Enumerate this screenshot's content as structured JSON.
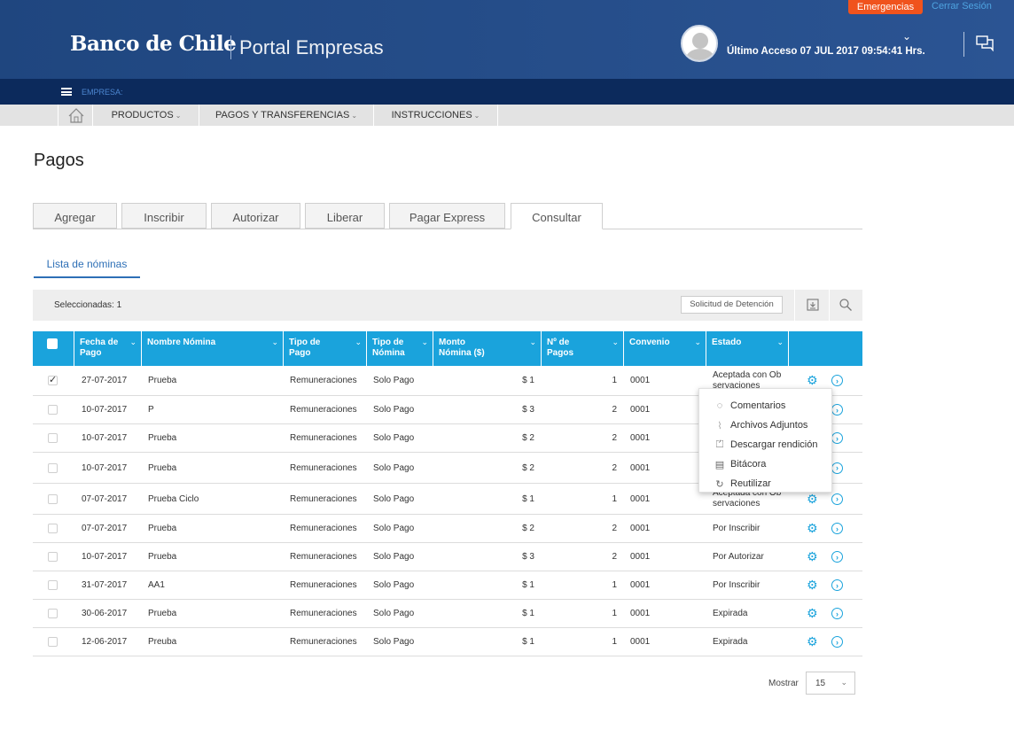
{
  "header": {
    "emergencias": "Emergencias",
    "cerrar_sesion": "Cerrar Sesión",
    "bank_name": "Banco de Chile",
    "portal": "Portal Empresas",
    "last_access": "Último Acceso 07 JUL 2017 09:54:41 Hrs.",
    "chevron": "⌄"
  },
  "company_bar": {
    "label": "EMPRESA:"
  },
  "nav": {
    "items": [
      {
        "label": "PRODUCTOS"
      },
      {
        "label": "PAGOS Y TRANSFERENCIAS"
      },
      {
        "label": "INSTRUCCIONES"
      }
    ]
  },
  "page": {
    "title": "Pagos"
  },
  "tabs": [
    "Agregar",
    "Inscribir",
    "Autorizar",
    "Liberar",
    "Pagar Express",
    "Consultar"
  ],
  "active_tab": "Consultar",
  "subtab": "Lista de nóminas",
  "toolbar": {
    "selected_count": "Seleccionadas: 1",
    "detention_button": "Solicitud de Detención"
  },
  "table": {
    "headers": [
      "Fecha de Pago",
      "Nombre Nómina",
      "Tipo de Pago",
      "Tipo de Nómina",
      "Monto Nómina ($)",
      "Nº de Pagos",
      "Convenio",
      "Estado"
    ],
    "rows": [
      {
        "checked": true,
        "fecha": "27-07-2017",
        "nombre": "Prueba",
        "tipo_pago": "Remuneraciones",
        "tipo_nomina": "Solo Pago",
        "monto": "$ 1",
        "pagos": "1",
        "convenio": "0001",
        "estado": "Aceptada con Ob servaciones"
      },
      {
        "checked": false,
        "fecha": "10-07-2017",
        "nombre": "P",
        "tipo_pago": "Remuneraciones",
        "tipo_nomina": "Solo Pago",
        "monto": "$ 3",
        "pagos": "2",
        "convenio": "0001",
        "estado": ""
      },
      {
        "checked": false,
        "fecha": "10-07-2017",
        "nombre": "Prueba",
        "tipo_pago": "Remuneraciones",
        "tipo_nomina": "Solo Pago",
        "monto": "$ 2",
        "pagos": "2",
        "convenio": "0001",
        "estado": ""
      },
      {
        "checked": false,
        "fecha": "10-07-2017",
        "nombre": "Prueba",
        "tipo_pago": "Remuneraciones",
        "tipo_nomina": "Solo Pago",
        "monto": "$ 2",
        "pagos": "2",
        "convenio": "0001",
        "estado": ""
      },
      {
        "checked": false,
        "fecha": "07-07-2017",
        "nombre": "Prueba Ciclo",
        "tipo_pago": "Remuneraciones",
        "tipo_nomina": "Solo Pago",
        "monto": "$ 1",
        "pagos": "1",
        "convenio": "0001",
        "estado": "Aceptada con Ob servaciones"
      },
      {
        "checked": false,
        "fecha": "07-07-2017",
        "nombre": "Prueba",
        "tipo_pago": "Remuneraciones",
        "tipo_nomina": "Solo Pago",
        "monto": "$ 2",
        "pagos": "2",
        "convenio": "0001",
        "estado": "Por Inscribir"
      },
      {
        "checked": false,
        "fecha": "10-07-2017",
        "nombre": "Prueba",
        "tipo_pago": "Remuneraciones",
        "tipo_nomina": "Solo Pago",
        "monto": "$ 3",
        "pagos": "2",
        "convenio": "0001",
        "estado": "Por Autorizar"
      },
      {
        "checked": false,
        "fecha": "31-07-2017",
        "nombre": "AA1",
        "tipo_pago": "Remuneraciones",
        "tipo_nomina": "Solo Pago",
        "monto": "$ 1",
        "pagos": "1",
        "convenio": "0001",
        "estado": "Por Inscribir"
      },
      {
        "checked": false,
        "fecha": "30-06-2017",
        "nombre": "Prueba",
        "tipo_pago": "Remuneraciones",
        "tipo_nomina": "Solo Pago",
        "monto": "$ 1",
        "pagos": "1",
        "convenio": "0001",
        "estado": "Expirada"
      },
      {
        "checked": false,
        "fecha": "12-06-2017",
        "nombre": "Preuba",
        "tipo_pago": "Remuneraciones",
        "tipo_nomina": "Solo Pago",
        "monto": "$ 1",
        "pagos": "1",
        "convenio": "0001",
        "estado": "Expirada"
      }
    ]
  },
  "row_menu": {
    "items": [
      {
        "label": "Comentarios",
        "icon": "comment-icon"
      },
      {
        "label": "Archivos Adjuntos",
        "icon": "paperclip-icon"
      },
      {
        "label": "Descargar rendición",
        "icon": "download-icon"
      },
      {
        "label": "Bitácora",
        "icon": "clipboard-icon"
      },
      {
        "label": "Reutilizar",
        "icon": "refresh-icon"
      }
    ]
  },
  "footer": {
    "mostrar_label": "Mostrar",
    "page_size": "15"
  },
  "colors": {
    "header_blue": "#2b5493",
    "company_bar": "#0c2a5c",
    "table_header": "#1aa3dc",
    "emergency": "#f0531d"
  }
}
